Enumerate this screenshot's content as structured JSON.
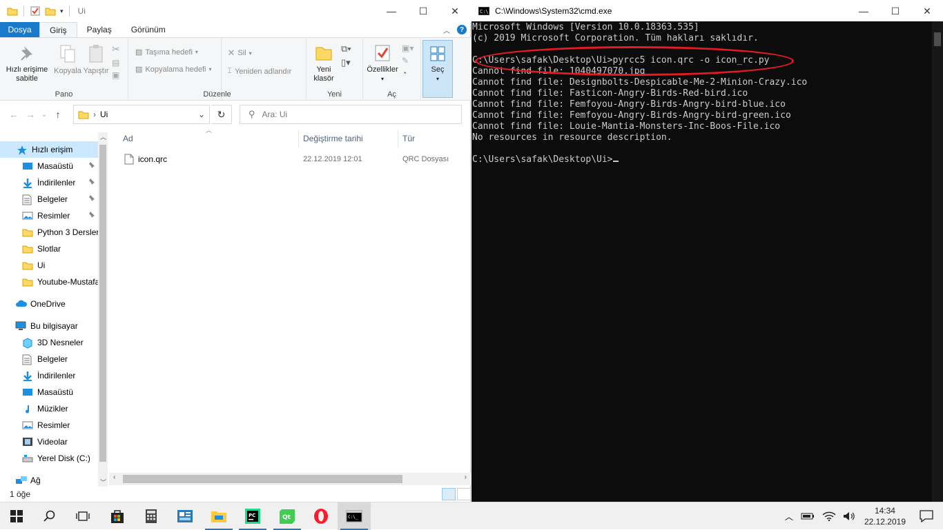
{
  "explorer": {
    "title": "Ui",
    "tabs": [
      "Dosya",
      "Giriş",
      "Paylaş",
      "Görünüm"
    ],
    "ribbon": {
      "pano": {
        "label": "Pano",
        "pin_label": "Hızlı erişime sabitle",
        "copy_label": "Kopyala",
        "paste_label": "Yapıştır"
      },
      "duzenle": {
        "label": "Düzenle",
        "move_to": "Taşıma hedefi",
        "copy_to": "Kopyalama hedefi",
        "delete": "Sil",
        "rename": "Yeniden adlandır"
      },
      "yeni": {
        "label": "Yeni",
        "new_folder": "Yeni klasör"
      },
      "ac": {
        "label": "Aç",
        "properties": "Özellikler"
      },
      "sec": {
        "label": "Seç"
      }
    },
    "address": {
      "path": "Ui",
      "search_placeholder": "Ara: Ui"
    },
    "sidebar": {
      "quick_access": "Hızlı erişim",
      "quick_items": [
        "Masaüstü",
        "İndirilenler",
        "Belgeler",
        "Resimler",
        "Python 3 Dersler",
        "Slotlar",
        "Ui",
        "Youtube-Mustafa"
      ],
      "onedrive": "OneDrive",
      "this_pc": "Bu bilgisayar",
      "pc_items": [
        "3D Nesneler",
        "Belgeler",
        "İndirilenler",
        "Masaüstü",
        "Müzikler",
        "Resimler",
        "Videolar",
        "Yerel Disk (C:)"
      ],
      "network": "Ağ"
    },
    "columns": {
      "name": "Ad",
      "date": "Değiştirme tarihi",
      "type": "Tür"
    },
    "files": [
      {
        "name": "icon.qrc",
        "date": "22.12.2019 12:01",
        "type": "QRC Dosyası"
      }
    ],
    "status": "1 öğe"
  },
  "cmd": {
    "title": "C:\\Windows\\System32\\cmd.exe",
    "lines": [
      "Microsoft Windows [Version 10.0.18363.535]",
      "(c) 2019 Microsoft Corporation. Tüm hakları saklıdır.",
      "",
      "C:\\Users\\safak\\Desktop\\Ui>pyrcc5 icon.qrc -o icon_rc.py",
      "Cannot find file: 1040497070.jpg",
      "Cannot find file: Designbolts-Despicable-Me-2-Minion-Crazy.ico",
      "Cannot find file: Fasticon-Angry-Birds-Red-bird.ico",
      "Cannot find file: Femfoyou-Angry-Birds-Angry-bird-blue.ico",
      "Cannot find file: Femfoyou-Angry-Birds-Angry-bird-green.ico",
      "Cannot find file: Louie-Mantia-Monsters-Inc-Boos-File.ico",
      "No resources in resource description.",
      ""
    ],
    "prompt": "C:\\Users\\safak\\Desktop\\Ui>"
  },
  "taskbar": {
    "time": "14:34",
    "date": "22.12.2019",
    "apps": [
      "start-icon",
      "search-icon",
      "task-view-icon",
      "store-icon",
      "calculator-icon",
      "app-icon",
      "file-explorer-icon",
      "pycharm-icon",
      "qt-icon",
      "opera-icon",
      "cmd-icon"
    ]
  },
  "colors": {
    "accent": "#1979ca",
    "highlight": "#e41b23",
    "selection": "#cce8ff"
  }
}
